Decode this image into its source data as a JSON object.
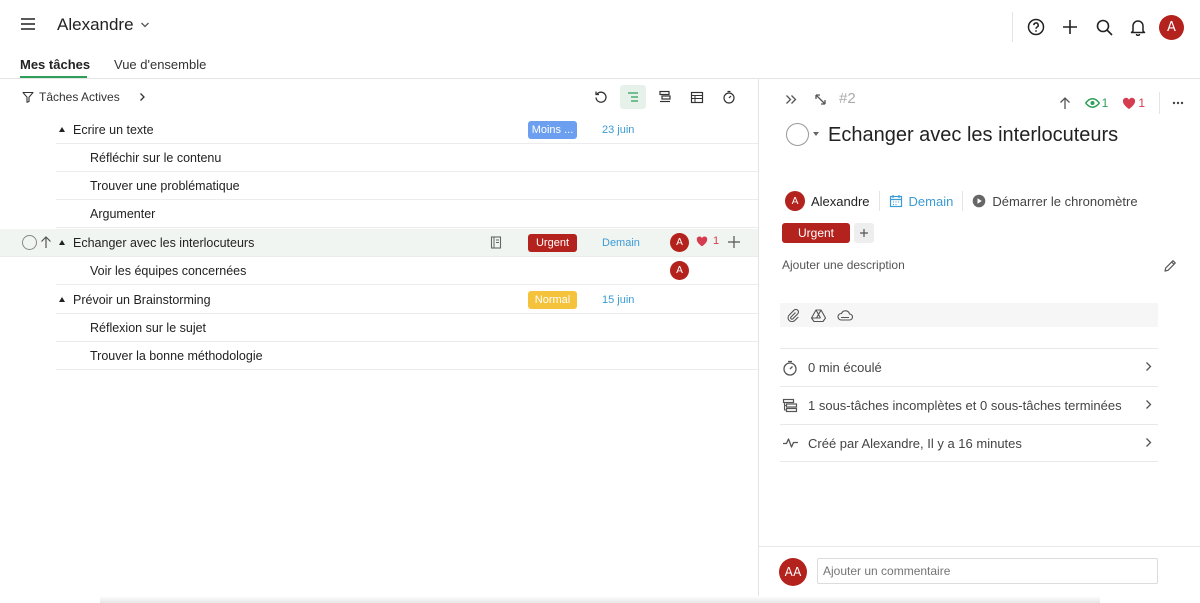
{
  "header": {
    "workspace": "Alexandre",
    "user_initial": "A"
  },
  "tabs": [
    {
      "label": "Mes tâches"
    },
    {
      "label": "Vue d'ensemble"
    }
  ],
  "filter": {
    "label": "Tâches Actives"
  },
  "tasks": [
    {
      "title": "Ecrire un texte",
      "badge": "Moins ...",
      "date": "23 juin"
    },
    {
      "title": "Réfléchir sur le contenu"
    },
    {
      "title": "Trouver une problématique"
    },
    {
      "title": "Argumenter"
    },
    {
      "title": "Echanger avec les interlocuteurs",
      "badge": "Urgent",
      "date": "Demain",
      "assignee": "A",
      "likes": "1"
    },
    {
      "title": "Voir les équipes concernées",
      "assignee": "A"
    },
    {
      "title": "Prévoir un Brainstorming",
      "badge": "Normal",
      "date": "15 juin"
    },
    {
      "title": "Réflexion sur le sujet"
    },
    {
      "title": "Trouver la bonne méthodologie"
    }
  ],
  "colors": {
    "urgent": "#b3221d",
    "normal": "#f4c23b",
    "moins": "#6d9ff1",
    "accent": "#2f9e58",
    "date": "#3b9bd4"
  },
  "detail": {
    "task_number": "#2",
    "watchers": "1",
    "likes": "1",
    "title": "Echanger avec les interlocuteurs",
    "assignee_initial": "A",
    "assignee": "Alexandre",
    "due": "Demain",
    "timer": "Démarrer le chronomètre",
    "tag": "Urgent",
    "description_placeholder": "Ajouter une description",
    "time_spent": "0 min écoulé",
    "subtasks_summary": "1 sous-tâches incomplètes et 0 sous-tâches terminées",
    "activity": "Créé par Alexandre, Il y a 16 minutes",
    "comment_initials": "AA",
    "comment_placeholder": "Ajouter un commentaire"
  }
}
